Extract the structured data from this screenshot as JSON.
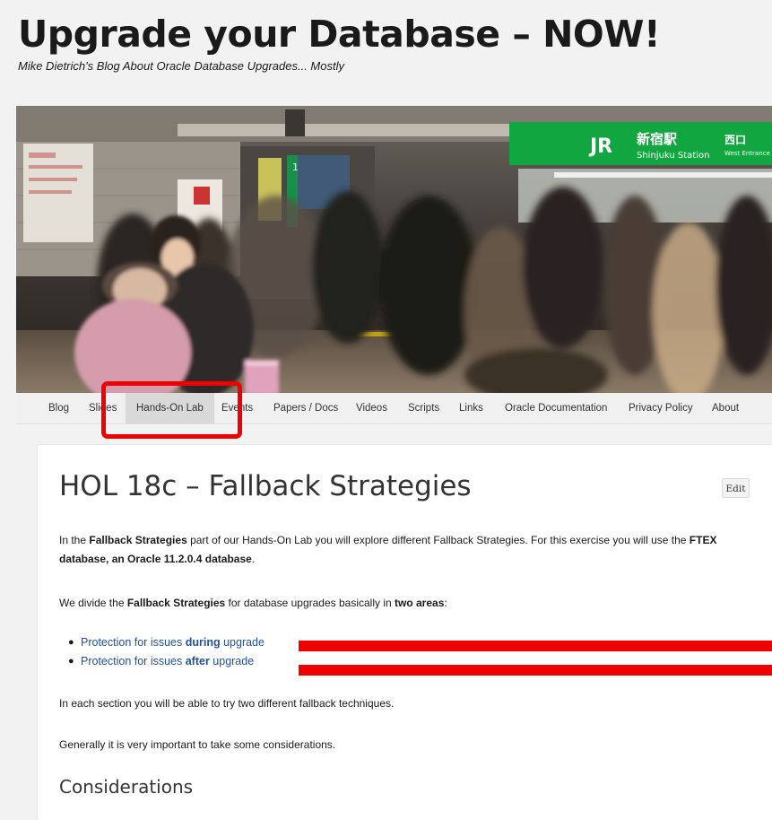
{
  "site": {
    "title": "Upgrade your Database – NOW!",
    "tagline": "Mike Dietrich's Blog About Oracle Database Upgrades... Mostly"
  },
  "header_image": {
    "sign_kanji": "新宿駅",
    "sign_station": "Shinjuku Station",
    "sign_exit_kanji": "西口",
    "sign_exit": "West Entrance",
    "sign_logo": "JR",
    "sign_number": "1"
  },
  "nav": {
    "items": [
      "Blog",
      "Slides",
      "Hands-On Lab",
      "Events",
      "Papers / Docs",
      "Videos",
      "Scripts",
      "Links",
      "Oracle Documentation",
      "Privacy Policy",
      "About"
    ],
    "active": "Hands-On Lab"
  },
  "post": {
    "title": "HOL 18c – Fallback Strategies",
    "edit_label": "Edit",
    "intro": {
      "t1": "In the ",
      "b1": "Fallback Strategies",
      "t2": " part of our Hands-On Lab you will explore different Fallback Strategies. For this exercise you will use the ",
      "b2": "FTEX database, an Oracle 11.2.0.4 database",
      "t3": "."
    },
    "divide": {
      "t1": "We divide the ",
      "b1": "Fallback Strategies",
      "t2": " for database upgrades basically in ",
      "b2": "two areas",
      "t3": ":"
    },
    "links": [
      {
        "pre": "Protection for issues ",
        "bold": "during",
        "post": " upgrade"
      },
      {
        "pre": "Protection for issues ",
        "bold": "after",
        "post": " upgrade"
      }
    ],
    "para_sections": "In each section you will be able to try two different fallback techniques.",
    "para_general": "Generally it is very important to take some considerations.",
    "section_heading": "Considerations"
  },
  "colors": {
    "annotation": "#ef0000",
    "link": "#21519e",
    "sign_green": "#11a63f"
  }
}
